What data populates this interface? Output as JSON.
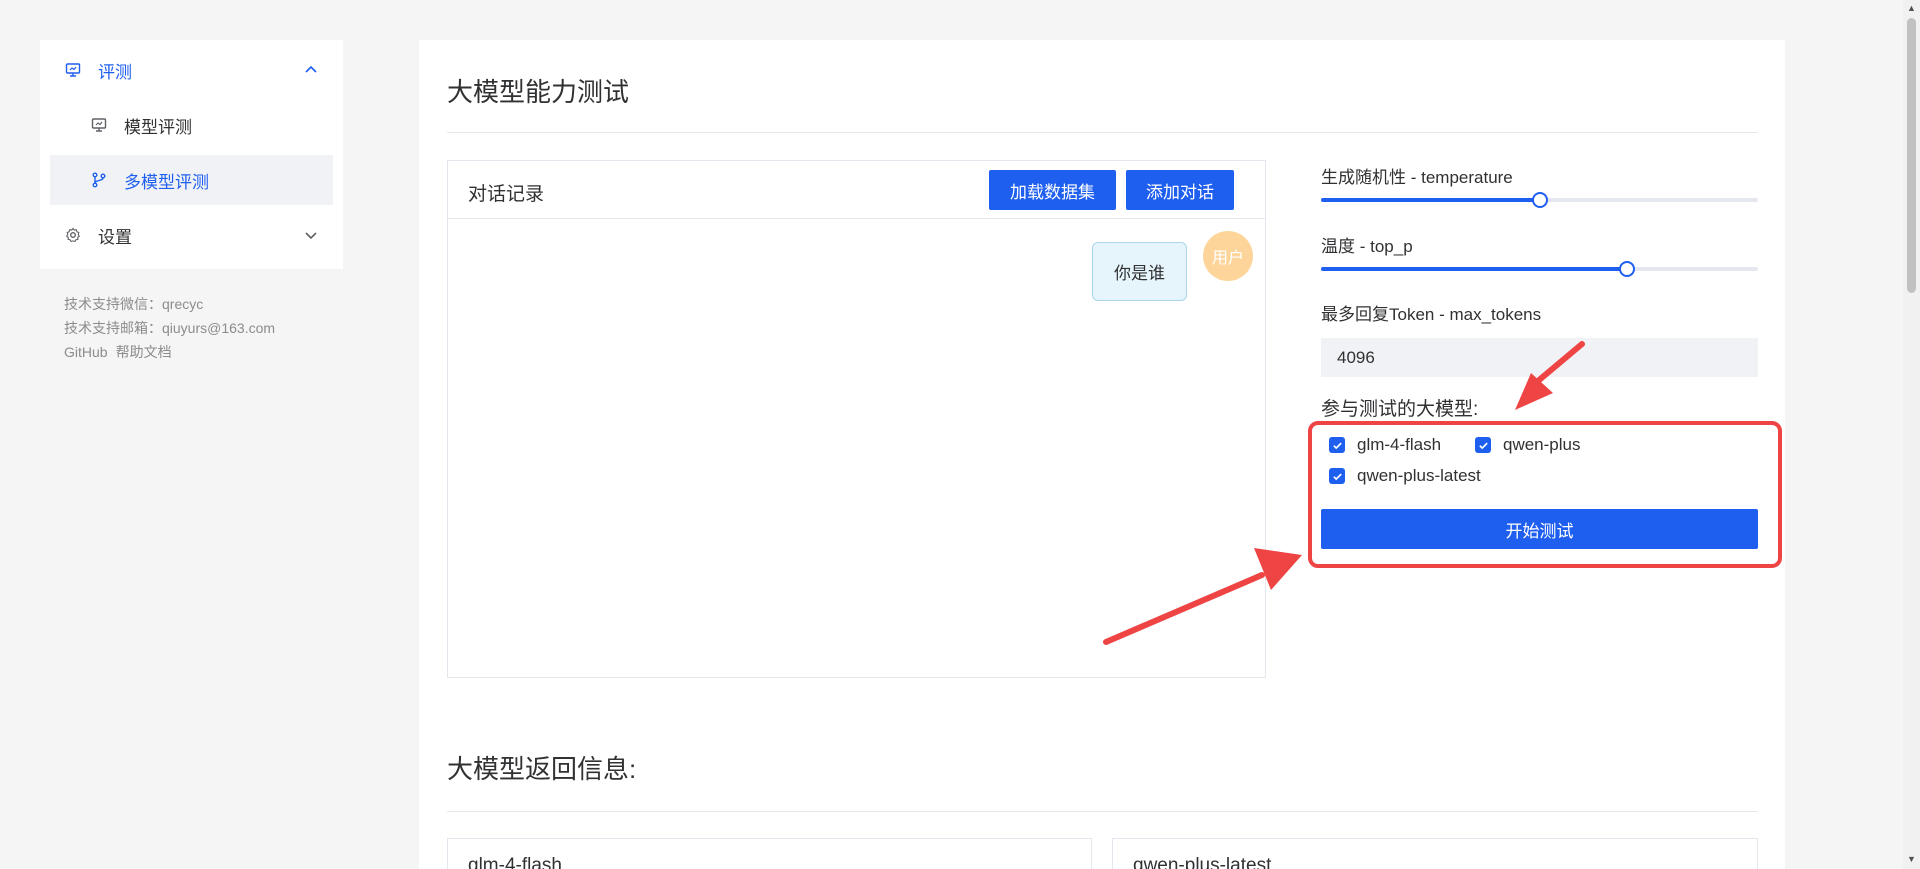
{
  "sidebar": {
    "eval_label": "评测",
    "model_eval_label": "模型评测",
    "multi_model_eval_label": "多模型评测",
    "settings_label": "设置"
  },
  "support": {
    "wechat": "技术支持微信：qrecyc",
    "email": "技术支持邮箱：qiuyurs@163.com",
    "github": "GitHub",
    "help_docs": "帮助文档"
  },
  "main": {
    "page_title": "大模型能力测试",
    "chat": {
      "title": "对话记录",
      "load_dataset_button": "加载数据集",
      "add_dialog_button": "添加对话",
      "messages": [
        {
          "role_label": "用户",
          "text": "你是谁"
        }
      ]
    },
    "settings": {
      "temperature_label": "生成随机性 - temperature",
      "temperature_value": 0.5,
      "top_p_label": "温度 - top_p",
      "top_p_value": 0.7,
      "max_tokens_label": "最多回复Token - max_tokens",
      "max_tokens_value": "4096",
      "models_label": "参与测试的大模型:",
      "models": [
        {
          "name": "glm-4-flash",
          "checked": true
        },
        {
          "name": "qwen-plus",
          "checked": true
        },
        {
          "name": "qwen-plus-latest",
          "checked": true
        }
      ],
      "start_button": "开始测试"
    },
    "results": {
      "title": "大模型返回信息:",
      "cards": [
        "glm-4-flash",
        "qwen-plus-latest"
      ]
    }
  },
  "colors": {
    "accent": "#1f5ff0",
    "annotation": "#ef4444",
    "avatar": "#fdd59b",
    "bubble_bg": "#e6f4fb"
  }
}
